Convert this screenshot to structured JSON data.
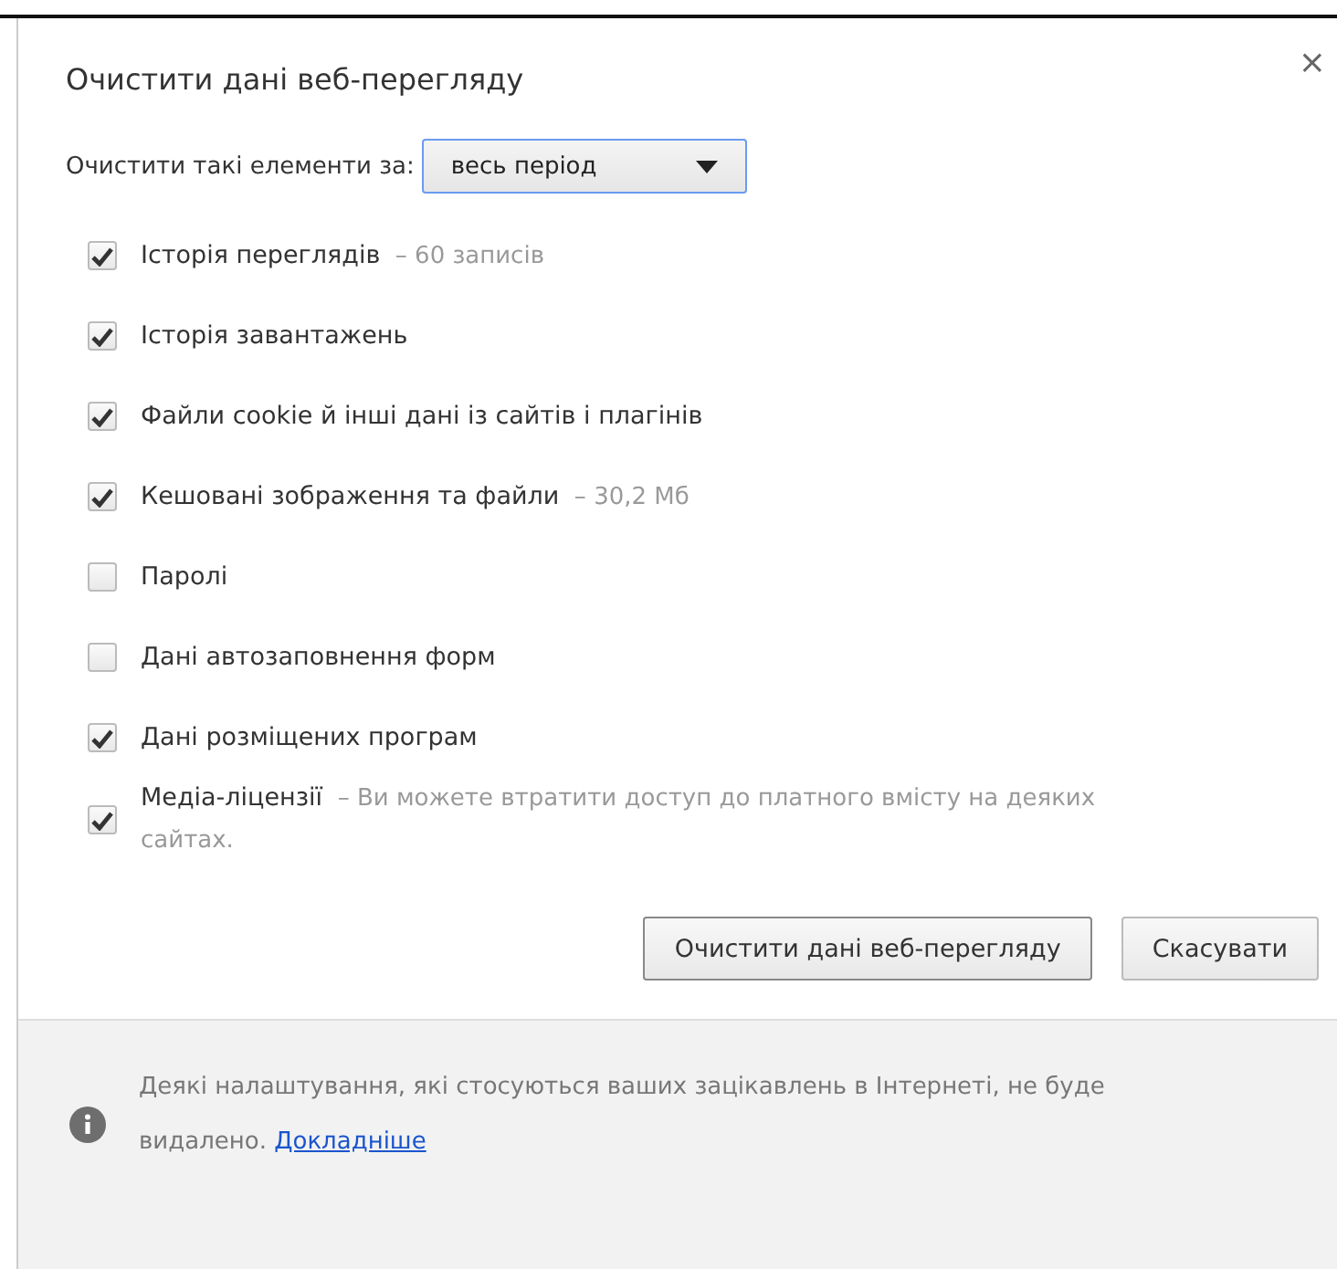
{
  "dialog": {
    "title": "Очистити дані веб-перегляду",
    "close": "×"
  },
  "period": {
    "label": "Очистити такі елементи за:",
    "value": "весь період"
  },
  "items": [
    {
      "label": "Історія переглядів",
      "note": "– 60 записів",
      "checked": true
    },
    {
      "label": "Історія завантажень",
      "checked": true
    },
    {
      "label": "Файли cookie й інші дані із сайтів і плагінів",
      "checked": true
    },
    {
      "label": "Кешовані зображення та файли",
      "note": "– 30,2 Мб",
      "checked": true
    },
    {
      "label": "Паролі",
      "checked": false
    },
    {
      "label": "Дані автозаповнення форм",
      "checked": false
    },
    {
      "label": "Дані розміщених програм",
      "checked": true
    },
    {
      "label": "Медіа-ліцензії",
      "note": "– Ви можете втратити доступ до платного вмісту на деяких сайтах.",
      "checked": true
    }
  ],
  "buttons": [
    "Очистити дані веб-перегляду",
    "Скасувати"
  ],
  "footer": {
    "text": "Деякі налаштування, які стосуються ваших зацікавлень в Інтернеті, не буде видалено.",
    "link": "Докладніше"
  }
}
